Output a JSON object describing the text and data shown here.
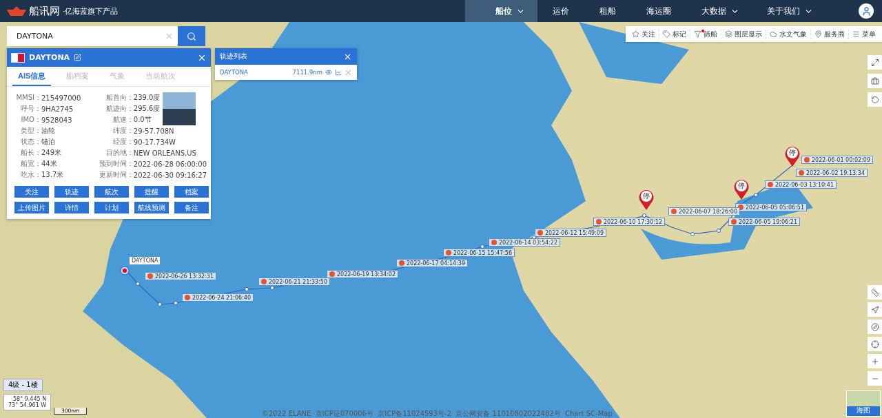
{
  "header": {
    "logo": "船讯网",
    "tagline": "·亿海蓝旗下产品",
    "nav": [
      {
        "label": "船位",
        "selected": true,
        "dropdown": true
      },
      {
        "label": "运价",
        "selected": false,
        "dropdown": false
      },
      {
        "label": "租船",
        "selected": false,
        "dropdown": false
      },
      {
        "label": "海运圈",
        "selected": false,
        "dropdown": false
      },
      {
        "label": "大数据",
        "selected": false,
        "dropdown": true
      },
      {
        "label": "关于我们",
        "selected": false,
        "dropdown": true
      }
    ]
  },
  "search": {
    "value": "DAYTONA"
  },
  "ship_panel": {
    "name": "DAYTONA",
    "tabs": [
      {
        "label": "AIS信息",
        "selected": true
      },
      {
        "label": "船档案",
        "selected": false
      },
      {
        "label": "气象",
        "selected": false
      },
      {
        "label": "当前航次",
        "selected": false
      }
    ],
    "fields_left": [
      {
        "label": "MMSI：",
        "value": "215497000"
      },
      {
        "label": "呼号：",
        "value": "9HA2745"
      },
      {
        "label": "IMO：",
        "value": "9528043"
      },
      {
        "label": "类型：",
        "value": "油轮"
      },
      {
        "label": "状态：",
        "value": "锚泊"
      },
      {
        "label": "船长：",
        "value": "249米"
      },
      {
        "label": "船宽：",
        "value": "44米"
      },
      {
        "label": "吃水：",
        "value": "13.7米"
      }
    ],
    "fields_right": [
      {
        "label": "船首向：",
        "value": "239.0度"
      },
      {
        "label": "航迹向：",
        "value": "295.6度"
      },
      {
        "label": "航速：",
        "value": "0.0节"
      },
      {
        "label": "纬度：",
        "value": "29-57.708N"
      },
      {
        "label": "经度：",
        "value": "90-17.734W"
      },
      {
        "label": "目的地：",
        "value": "NEW ORLEANS,US"
      },
      {
        "label": "预到时间：",
        "value": "2022-06-28 06:00:00"
      },
      {
        "label": "更新时间：",
        "value": "2022-06-30 09:16:27"
      }
    ],
    "buttons": [
      "关注",
      "轨迹",
      "航次",
      "提醒",
      "档案",
      "上传图片",
      "详情",
      "计划",
      "航线预测",
      "备注"
    ]
  },
  "track_list": {
    "title": "轨迹列表",
    "items": [
      {
        "name": "DAYTONA",
        "distance": "7111.9nm"
      }
    ]
  },
  "map_toolbar": [
    {
      "label": "关注",
      "badge": false
    },
    {
      "label": "标记",
      "badge": false
    },
    {
      "label": "筛船",
      "badge": true
    },
    {
      "label": "图层显示",
      "badge": false
    },
    {
      "label": "水文气象",
      "badge": false
    },
    {
      "label": "服务商",
      "badge": false
    },
    {
      "label": "菜单",
      "badge": false
    }
  ],
  "map": {
    "ship_label": "DAYTONA",
    "stops": [
      "停",
      "停",
      "停"
    ],
    "track_points": [
      "2022-06-01 00:02:09",
      "2022-06-02 19:13:34",
      "2022-06-03 13:10:41",
      "2022-06-05 05:06:51",
      "2022-06-05 19:06:21",
      "2022-06-07 18:26:00",
      "2022-06-10 17:30:12",
      "2022-06-12 15:49:09",
      "2022-06-14 03:54:22",
      "2022-06-15 15:47:56",
      "2022-06-17 04:14:39",
      "2022-06-19 13:34:02",
      "2022-06-21 21:33:50",
      "2022-06-24 21:06:40",
      "2022-06-26 13:32:31"
    ]
  },
  "zoom_level": "4级 - 1楼",
  "coords": [
    "58° 9.445 N",
    "73° 54.961 W"
  ],
  "scale": "300nm",
  "copyright": "©2022 ELANE  京ICP证070006号  京ICP备11024593号-2  京公网安备 11010802022482号  Chart SC-Map",
  "layer_switch": "海图"
}
